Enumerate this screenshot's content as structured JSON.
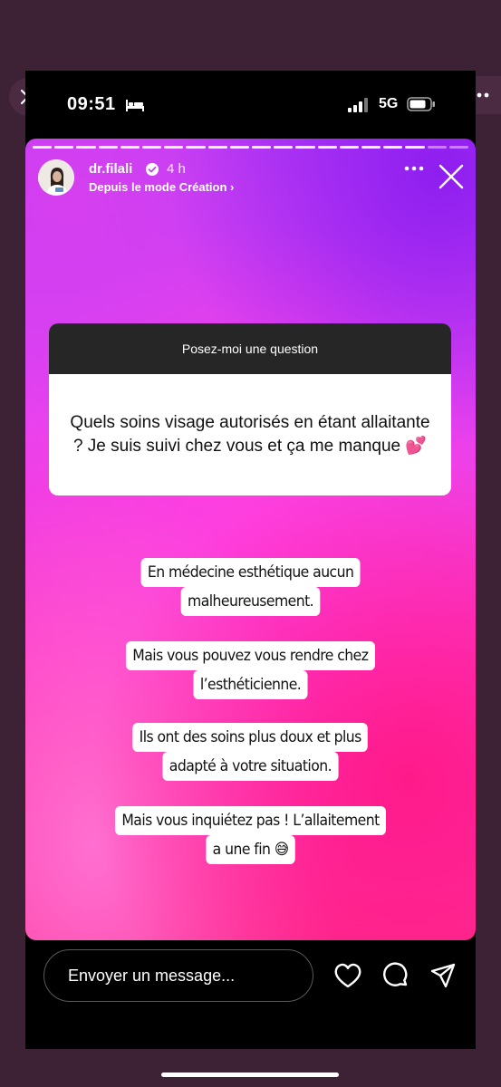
{
  "status_bar": {
    "time": "09:51",
    "network": "5G",
    "icons": [
      "bed-icon",
      "signal-icon",
      "battery-icon"
    ]
  },
  "story": {
    "username": "dr.filali",
    "time_ago": "4 h",
    "subtitle": "Depuis le mode Création ›",
    "progress_total": 20,
    "progress_done": 18,
    "question_box": {
      "header": "Posez-moi une question",
      "question": "Quels soins visage autorisés en étant allaitante ? Je suis suivi chez vous et ça me manque 💕"
    },
    "replies": [
      {
        "line1": "En médecine esthétique aucun",
        "line2": "malheureusement."
      },
      {
        "line1": "Mais vous pouvez vous rendre chez",
        "line2": "l’esthéticienne."
      },
      {
        "line1": "Ils ont des soins plus doux et plus",
        "line2": "adapté à votre situation."
      },
      {
        "line1": "Mais vous inquiétez pas ! L’allaitement",
        "line2": "a une fin 😅"
      }
    ]
  },
  "bottom_bar": {
    "message_placeholder": "Envoyer un message...",
    "icons": [
      "heart-icon",
      "comment-icon",
      "send-icon"
    ]
  },
  "colors": {
    "frame": "#3d2236",
    "story_gradient": [
      "#b93ff5",
      "#e742f0",
      "#ff36c8",
      "#ff2d8e"
    ],
    "question_header": "#262626"
  }
}
